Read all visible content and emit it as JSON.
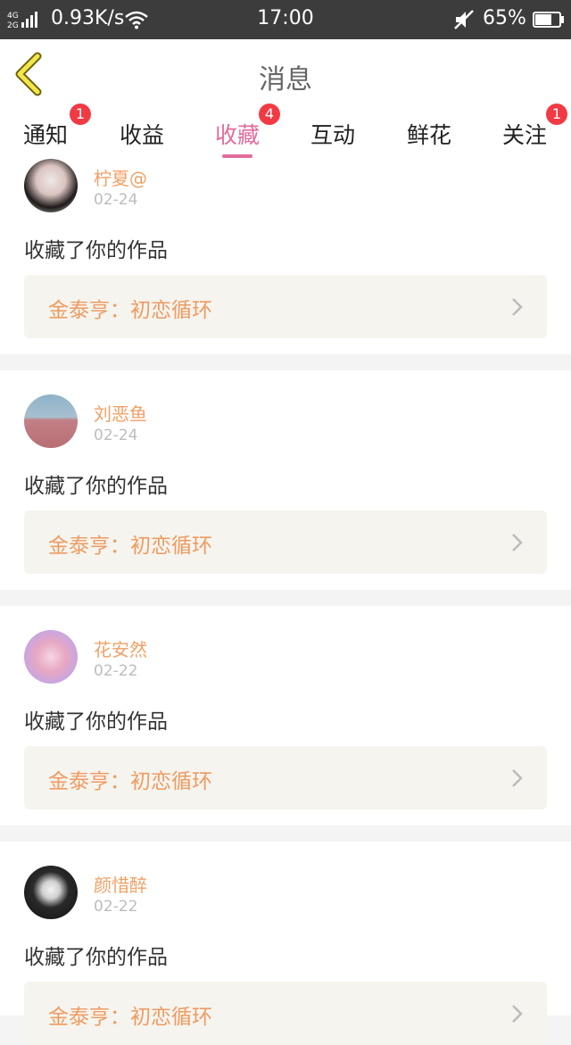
{
  "status_bar": {
    "network": "4G 2G",
    "speed": "0.93K/s",
    "time": "17:00",
    "battery": "65%"
  },
  "header": {
    "title": "消息"
  },
  "tabs": [
    {
      "label": "通知",
      "badge": "1"
    },
    {
      "label": "收益",
      "badge": ""
    },
    {
      "label": "收藏",
      "badge": "4"
    },
    {
      "label": "互动",
      "badge": ""
    },
    {
      "label": "鲜花",
      "badge": ""
    },
    {
      "label": "关注",
      "badge": "1"
    }
  ],
  "active_tab": "收藏",
  "items": [
    {
      "user": "柠夏@",
      "date": "02-24",
      "action": "收藏了你的作品",
      "work": "金泰亨：初恋循环"
    },
    {
      "user": "刘恶鱼",
      "date": "02-24",
      "action": "收藏了你的作品",
      "work": "金泰亨：初恋循环"
    },
    {
      "user": "花安然",
      "date": "02-22",
      "action": "收藏了你的作品",
      "work": "金泰亨：初恋循环"
    },
    {
      "user": "颜惜醉",
      "date": "02-22",
      "action": "收藏了你的作品",
      "work": "金泰亨：初恋循环"
    }
  ],
  "colors": {
    "accent": "#e16b9c",
    "badge": "#f23a44",
    "username": "#f0a066",
    "work_title": "#ee9b62",
    "status_bar": "#3c3c3c"
  }
}
